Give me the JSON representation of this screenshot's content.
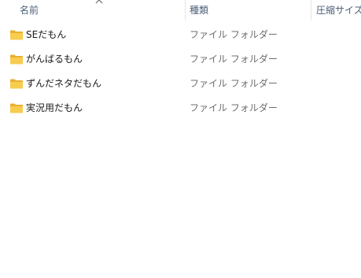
{
  "columns": {
    "name": "名前",
    "type": "種類",
    "compressed_size": "圧縮サイズ"
  },
  "sort": {
    "column": "name",
    "direction": "ascending"
  },
  "items": [
    {
      "name": "SEだもん",
      "type": "ファイル フォルダー",
      "icon": "folder-icon"
    },
    {
      "name": "がんばるもん",
      "type": "ファイル フォルダー",
      "icon": "folder-icon"
    },
    {
      "name": "ずんだネタだもん",
      "type": "ファイル フォルダー",
      "icon": "folder-icon"
    },
    {
      "name": "実況用だもん",
      "type": "ファイル フォルダー",
      "icon": "folder-icon"
    }
  ],
  "colors": {
    "folder": "#f4c542",
    "header_text": "#4c607a",
    "secondary_text": "#6d6d6d"
  }
}
